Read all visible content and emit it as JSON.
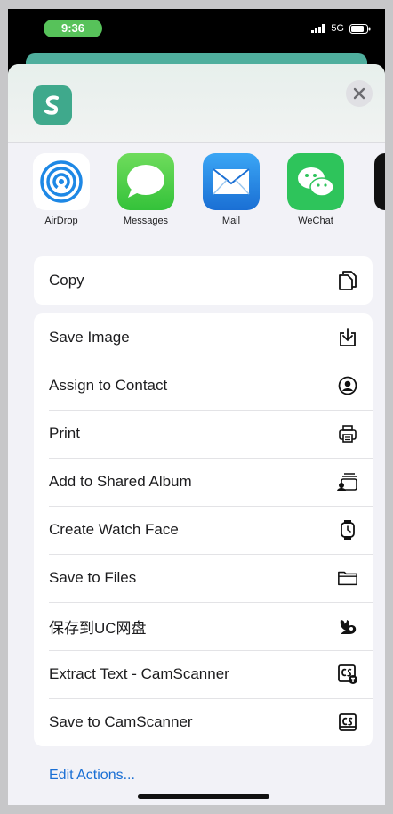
{
  "status": {
    "time": "9:36",
    "network": "5G"
  },
  "share_targets": [
    {
      "label": "AirDrop",
      "icon": "airdrop-icon"
    },
    {
      "label": "Messages",
      "icon": "messages-icon"
    },
    {
      "label": "Mail",
      "icon": "mail-icon"
    },
    {
      "label": "WeChat",
      "icon": "wechat-icon"
    }
  ],
  "copy_group": [
    {
      "label": "Copy",
      "icon": "copy-icon"
    }
  ],
  "actions": [
    {
      "label": "Save Image",
      "icon": "save-image-icon"
    },
    {
      "label": "Assign to Contact",
      "icon": "contact-icon"
    },
    {
      "label": "Print",
      "icon": "print-icon"
    },
    {
      "label": "Add to Shared Album",
      "icon": "shared-album-icon"
    },
    {
      "label": "Create Watch Face",
      "icon": "watch-icon"
    },
    {
      "label": "Save to Files",
      "icon": "folder-icon"
    },
    {
      "label": "保存到UC网盘",
      "icon": "uc-icon"
    },
    {
      "label": "Extract Text - CamScanner",
      "icon": "camscanner-extract-icon"
    },
    {
      "label": "Save to CamScanner",
      "icon": "camscanner-icon"
    }
  ],
  "edit_actions_label": "Edit Actions...",
  "colors": {
    "accent": "#1a6fd4",
    "app_green": "#3fa98c",
    "time_pill": "#57c25a"
  }
}
